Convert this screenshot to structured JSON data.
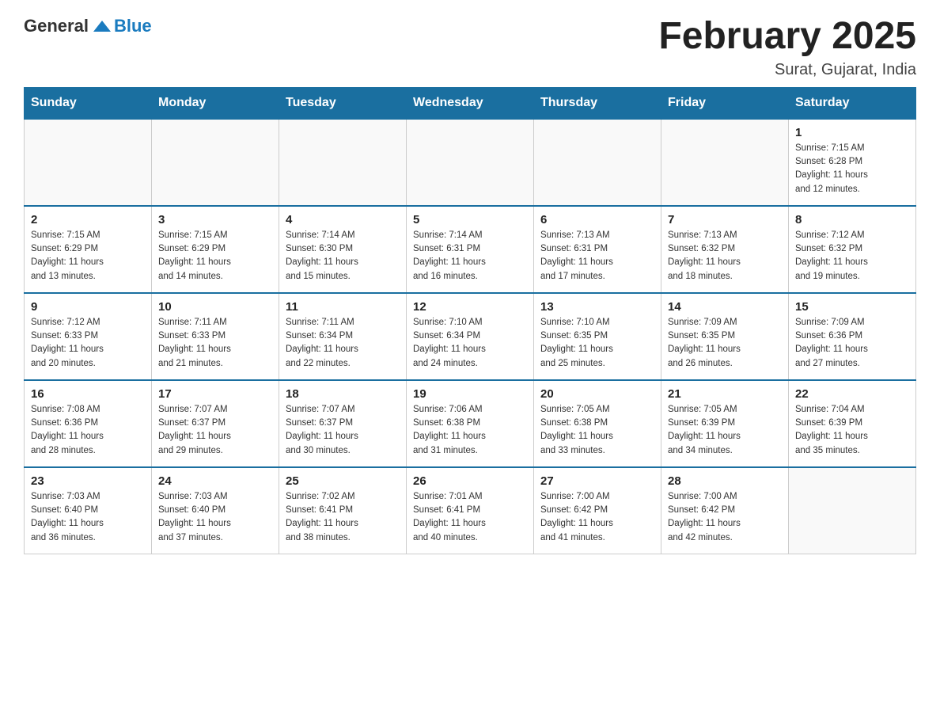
{
  "header": {
    "logo_general": "General",
    "logo_blue": "Blue",
    "month_title": "February 2025",
    "location": "Surat, Gujarat, India"
  },
  "weekdays": [
    "Sunday",
    "Monday",
    "Tuesday",
    "Wednesday",
    "Thursday",
    "Friday",
    "Saturday"
  ],
  "weeks": [
    [
      {
        "day": "",
        "info": ""
      },
      {
        "day": "",
        "info": ""
      },
      {
        "day": "",
        "info": ""
      },
      {
        "day": "",
        "info": ""
      },
      {
        "day": "",
        "info": ""
      },
      {
        "day": "",
        "info": ""
      },
      {
        "day": "1",
        "info": "Sunrise: 7:15 AM\nSunset: 6:28 PM\nDaylight: 11 hours\nand 12 minutes."
      }
    ],
    [
      {
        "day": "2",
        "info": "Sunrise: 7:15 AM\nSunset: 6:29 PM\nDaylight: 11 hours\nand 13 minutes."
      },
      {
        "day": "3",
        "info": "Sunrise: 7:15 AM\nSunset: 6:29 PM\nDaylight: 11 hours\nand 14 minutes."
      },
      {
        "day": "4",
        "info": "Sunrise: 7:14 AM\nSunset: 6:30 PM\nDaylight: 11 hours\nand 15 minutes."
      },
      {
        "day": "5",
        "info": "Sunrise: 7:14 AM\nSunset: 6:31 PM\nDaylight: 11 hours\nand 16 minutes."
      },
      {
        "day": "6",
        "info": "Sunrise: 7:13 AM\nSunset: 6:31 PM\nDaylight: 11 hours\nand 17 minutes."
      },
      {
        "day": "7",
        "info": "Sunrise: 7:13 AM\nSunset: 6:32 PM\nDaylight: 11 hours\nand 18 minutes."
      },
      {
        "day": "8",
        "info": "Sunrise: 7:12 AM\nSunset: 6:32 PM\nDaylight: 11 hours\nand 19 minutes."
      }
    ],
    [
      {
        "day": "9",
        "info": "Sunrise: 7:12 AM\nSunset: 6:33 PM\nDaylight: 11 hours\nand 20 minutes."
      },
      {
        "day": "10",
        "info": "Sunrise: 7:11 AM\nSunset: 6:33 PM\nDaylight: 11 hours\nand 21 minutes."
      },
      {
        "day": "11",
        "info": "Sunrise: 7:11 AM\nSunset: 6:34 PM\nDaylight: 11 hours\nand 22 minutes."
      },
      {
        "day": "12",
        "info": "Sunrise: 7:10 AM\nSunset: 6:34 PM\nDaylight: 11 hours\nand 24 minutes."
      },
      {
        "day": "13",
        "info": "Sunrise: 7:10 AM\nSunset: 6:35 PM\nDaylight: 11 hours\nand 25 minutes."
      },
      {
        "day": "14",
        "info": "Sunrise: 7:09 AM\nSunset: 6:35 PM\nDaylight: 11 hours\nand 26 minutes."
      },
      {
        "day": "15",
        "info": "Sunrise: 7:09 AM\nSunset: 6:36 PM\nDaylight: 11 hours\nand 27 minutes."
      }
    ],
    [
      {
        "day": "16",
        "info": "Sunrise: 7:08 AM\nSunset: 6:36 PM\nDaylight: 11 hours\nand 28 minutes."
      },
      {
        "day": "17",
        "info": "Sunrise: 7:07 AM\nSunset: 6:37 PM\nDaylight: 11 hours\nand 29 minutes."
      },
      {
        "day": "18",
        "info": "Sunrise: 7:07 AM\nSunset: 6:37 PM\nDaylight: 11 hours\nand 30 minutes."
      },
      {
        "day": "19",
        "info": "Sunrise: 7:06 AM\nSunset: 6:38 PM\nDaylight: 11 hours\nand 31 minutes."
      },
      {
        "day": "20",
        "info": "Sunrise: 7:05 AM\nSunset: 6:38 PM\nDaylight: 11 hours\nand 33 minutes."
      },
      {
        "day": "21",
        "info": "Sunrise: 7:05 AM\nSunset: 6:39 PM\nDaylight: 11 hours\nand 34 minutes."
      },
      {
        "day": "22",
        "info": "Sunrise: 7:04 AM\nSunset: 6:39 PM\nDaylight: 11 hours\nand 35 minutes."
      }
    ],
    [
      {
        "day": "23",
        "info": "Sunrise: 7:03 AM\nSunset: 6:40 PM\nDaylight: 11 hours\nand 36 minutes."
      },
      {
        "day": "24",
        "info": "Sunrise: 7:03 AM\nSunset: 6:40 PM\nDaylight: 11 hours\nand 37 minutes."
      },
      {
        "day": "25",
        "info": "Sunrise: 7:02 AM\nSunset: 6:41 PM\nDaylight: 11 hours\nand 38 minutes."
      },
      {
        "day": "26",
        "info": "Sunrise: 7:01 AM\nSunset: 6:41 PM\nDaylight: 11 hours\nand 40 minutes."
      },
      {
        "day": "27",
        "info": "Sunrise: 7:00 AM\nSunset: 6:42 PM\nDaylight: 11 hours\nand 41 minutes."
      },
      {
        "day": "28",
        "info": "Sunrise: 7:00 AM\nSunset: 6:42 PM\nDaylight: 11 hours\nand 42 minutes."
      },
      {
        "day": "",
        "info": ""
      }
    ]
  ]
}
